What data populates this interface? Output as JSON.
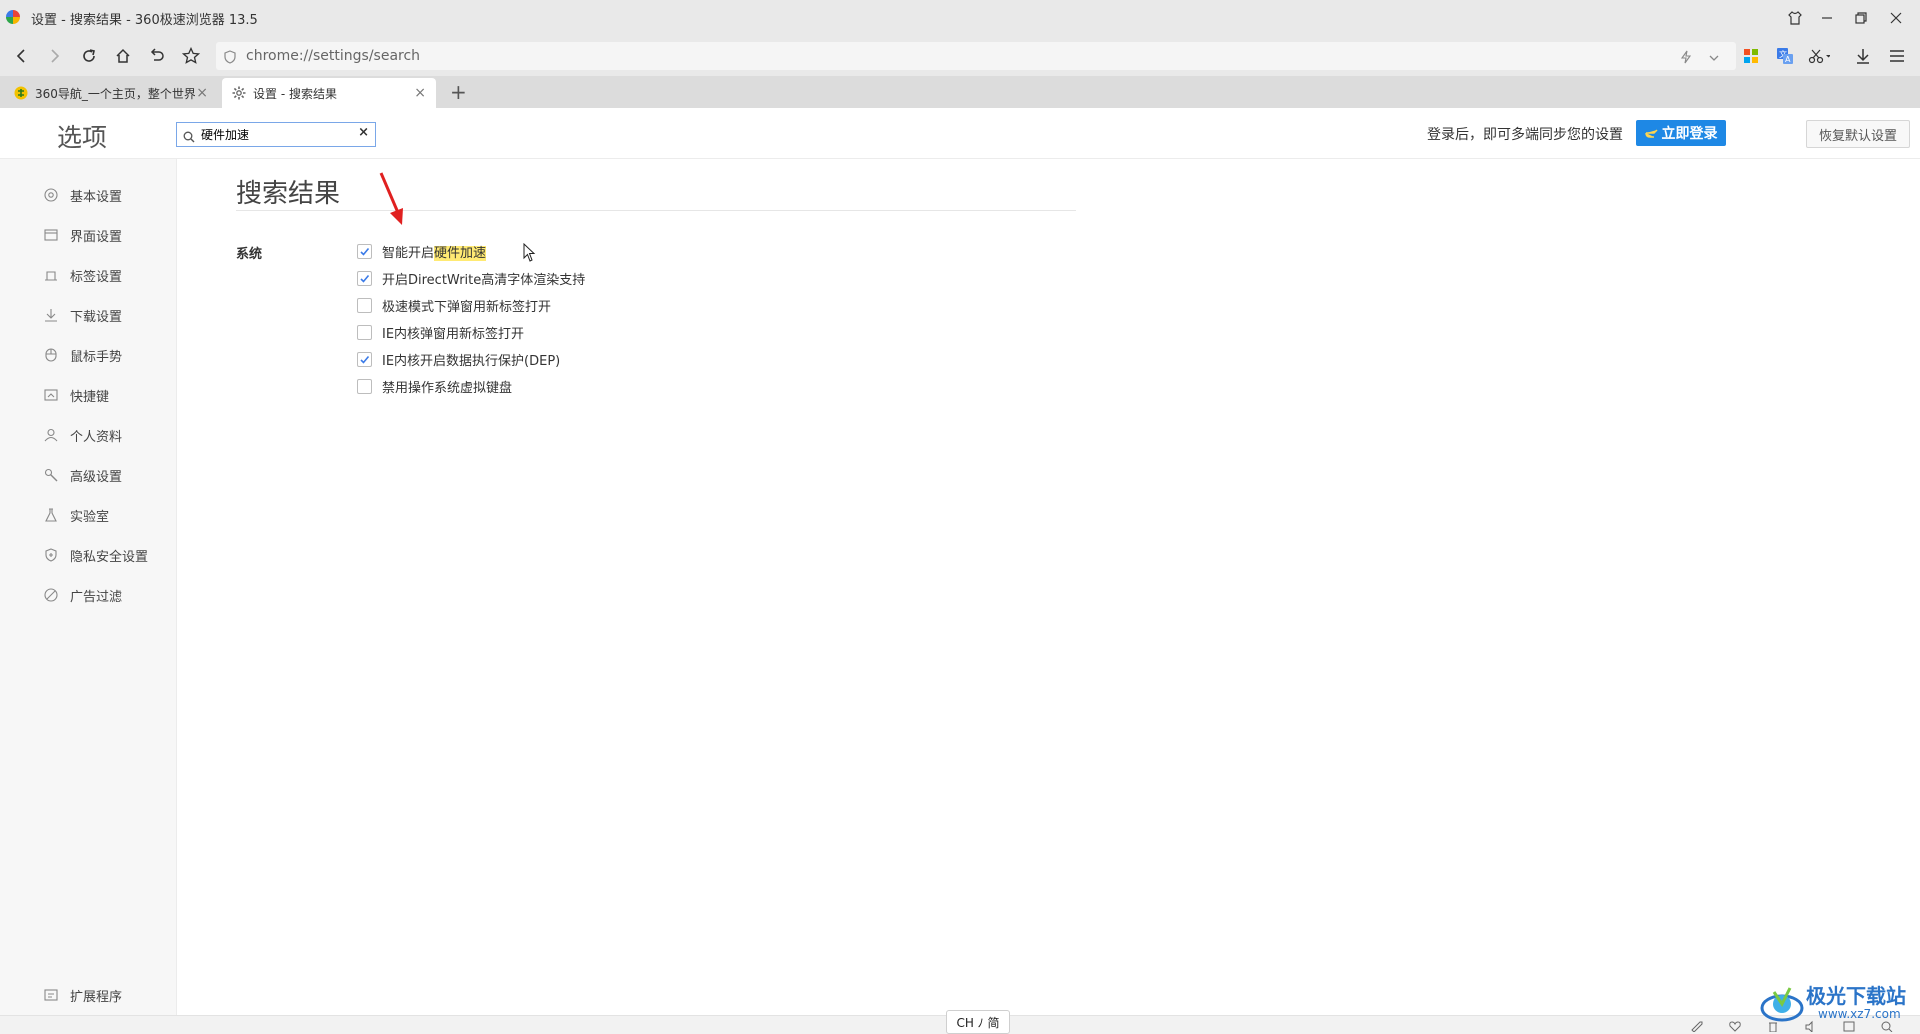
{
  "window": {
    "title": "设置 - 搜索结果 - 360极速浏览器 13.5"
  },
  "navbar": {
    "url": "chrome://settings/search"
  },
  "tabs": [
    {
      "label": "360导航_一个主页，整个世界",
      "close": "×"
    },
    {
      "label": "设置 - 搜索结果",
      "close": "×"
    }
  ],
  "newtab_label": "+",
  "header": {
    "heading": "选项",
    "search_value": "硬件加速",
    "search_clear": "×",
    "login_hint": "登录后，即可多端同步您的设置",
    "login_button": "立即登录",
    "restore_button": "恢复默认设置"
  },
  "sidebar": {
    "items": [
      {
        "label": "基本设置",
        "icon": "settings-circle-icon"
      },
      {
        "label": "界面设置",
        "icon": "window-icon"
      },
      {
        "label": "标签设置",
        "icon": "tab-icon"
      },
      {
        "label": "下载设置",
        "icon": "download-icon"
      },
      {
        "label": "鼠标手势",
        "icon": "mouse-icon"
      },
      {
        "label": "快捷键",
        "icon": "keyboard-icon"
      },
      {
        "label": "个人资料",
        "icon": "user-icon"
      },
      {
        "label": "高级设置",
        "icon": "wrench-icon"
      },
      {
        "label": "实验室",
        "icon": "flask-icon"
      },
      {
        "label": "隐私安全设置",
        "icon": "shield-icon"
      },
      {
        "label": "广告过滤",
        "icon": "block-icon"
      }
    ],
    "extensions": "扩展程序"
  },
  "main": {
    "title": "搜索结果",
    "section": "系统",
    "options": [
      {
        "pre": "智能开启",
        "highlight": "硬件加速",
        "post": "",
        "checked": true
      },
      {
        "pre": "开启DirectWrite高清字体渲染支持",
        "highlight": "",
        "post": "",
        "checked": true
      },
      {
        "pre": "极速模式下弹窗用新标签打开",
        "highlight": "",
        "post": "",
        "checked": false
      },
      {
        "pre": "IE内核弹窗用新标签打开",
        "highlight": "",
        "post": "",
        "checked": false
      },
      {
        "pre": "IE内核开启数据执行保护(DEP)",
        "highlight": "",
        "post": "",
        "checked": true
      },
      {
        "pre": "禁用操作系统虚拟键盘",
        "highlight": "",
        "post": "",
        "checked": false
      }
    ]
  },
  "statusbar": {
    "ime": "CH ﾉ 简"
  },
  "watermark": {
    "name": "极光下载站",
    "url": "www.xz7.com"
  },
  "colors": {
    "accent": "#1e88e5",
    "highlight": "#ffea73",
    "annotation_arrow": "#e02020"
  }
}
